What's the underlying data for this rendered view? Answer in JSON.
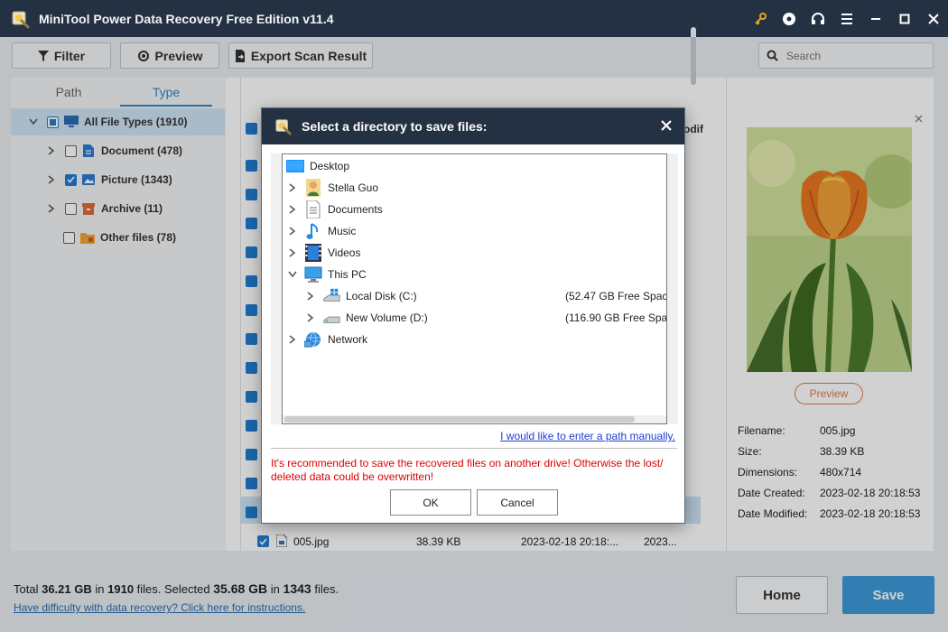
{
  "app": {
    "title": "MiniTool Power Data Recovery Free Edition v11.4"
  },
  "toolbar": {
    "filter_label": "Filter",
    "preview_label": "Preview",
    "export_label": "Export Scan Result",
    "search_placeholder": "Search"
  },
  "tabs": [
    {
      "label": "Path"
    },
    {
      "label": "Type"
    }
  ],
  "type_tree": [
    {
      "label": "All File Types (1910)"
    },
    {
      "label": "Document (478)"
    },
    {
      "label": "Picture (1343)"
    },
    {
      "label": "Archive (11)"
    },
    {
      "label": "Other files (78)"
    }
  ],
  "list": {
    "header_partial": "odif",
    "row_name": "005.jpg",
    "row_size": "38.39 KB",
    "row_date": "2023-02-18 20:18:...",
    "row_modified": "2023..."
  },
  "preview": {
    "button_label": "Preview",
    "labels": {
      "filename": "Filename:",
      "size": "Size:",
      "dimensions": "Dimensions:",
      "created": "Date Created:",
      "modified": "Date Modified:"
    },
    "values": {
      "filename": "005.jpg",
      "size": "38.39 KB",
      "dimensions": "480x714",
      "created": "2023-02-18 20:18:53",
      "modified": "2023-02-18 20:18:53"
    }
  },
  "footer": {
    "total_prefix": "Total",
    "total_size": "36.21 GB",
    "in1": "in",
    "total_files": "1910",
    "files_selected": "files.  Selected",
    "selected_size": "35.68 GB",
    "in2": "in",
    "selected_files": "1343",
    "files_end": "files.",
    "help_link": "Have difficulty with data recovery? Click here for instructions.",
    "home_label": "Home",
    "save_label": "Save"
  },
  "dialog": {
    "title": "Select a directory to save files:",
    "nodes": [
      {
        "label": "Desktop"
      },
      {
        "label": "Stella Guo"
      },
      {
        "label": "Documents"
      },
      {
        "label": "Music"
      },
      {
        "label": "Videos"
      },
      {
        "label": "This PC"
      },
      {
        "label": "Local Disk (C:)",
        "free": "(52.47 GB Free Spac"
      },
      {
        "label": "New Volume (D:)",
        "free": "(116.90 GB Free Spa"
      },
      {
        "label": "Network"
      }
    ],
    "manual_link": "I would like to enter a path manually.",
    "warning": "It's recommended to save the recovered files on another drive! Otherwise the lost/ deleted data could be overwritten!",
    "ok_label": "OK",
    "cancel_label": "Cancel"
  },
  "colors": {
    "titlebar": "#243142",
    "accent": "#2b88c8",
    "save_button": "#3d9ad9",
    "warning": "#e00000",
    "link": "#1c3fd0"
  }
}
